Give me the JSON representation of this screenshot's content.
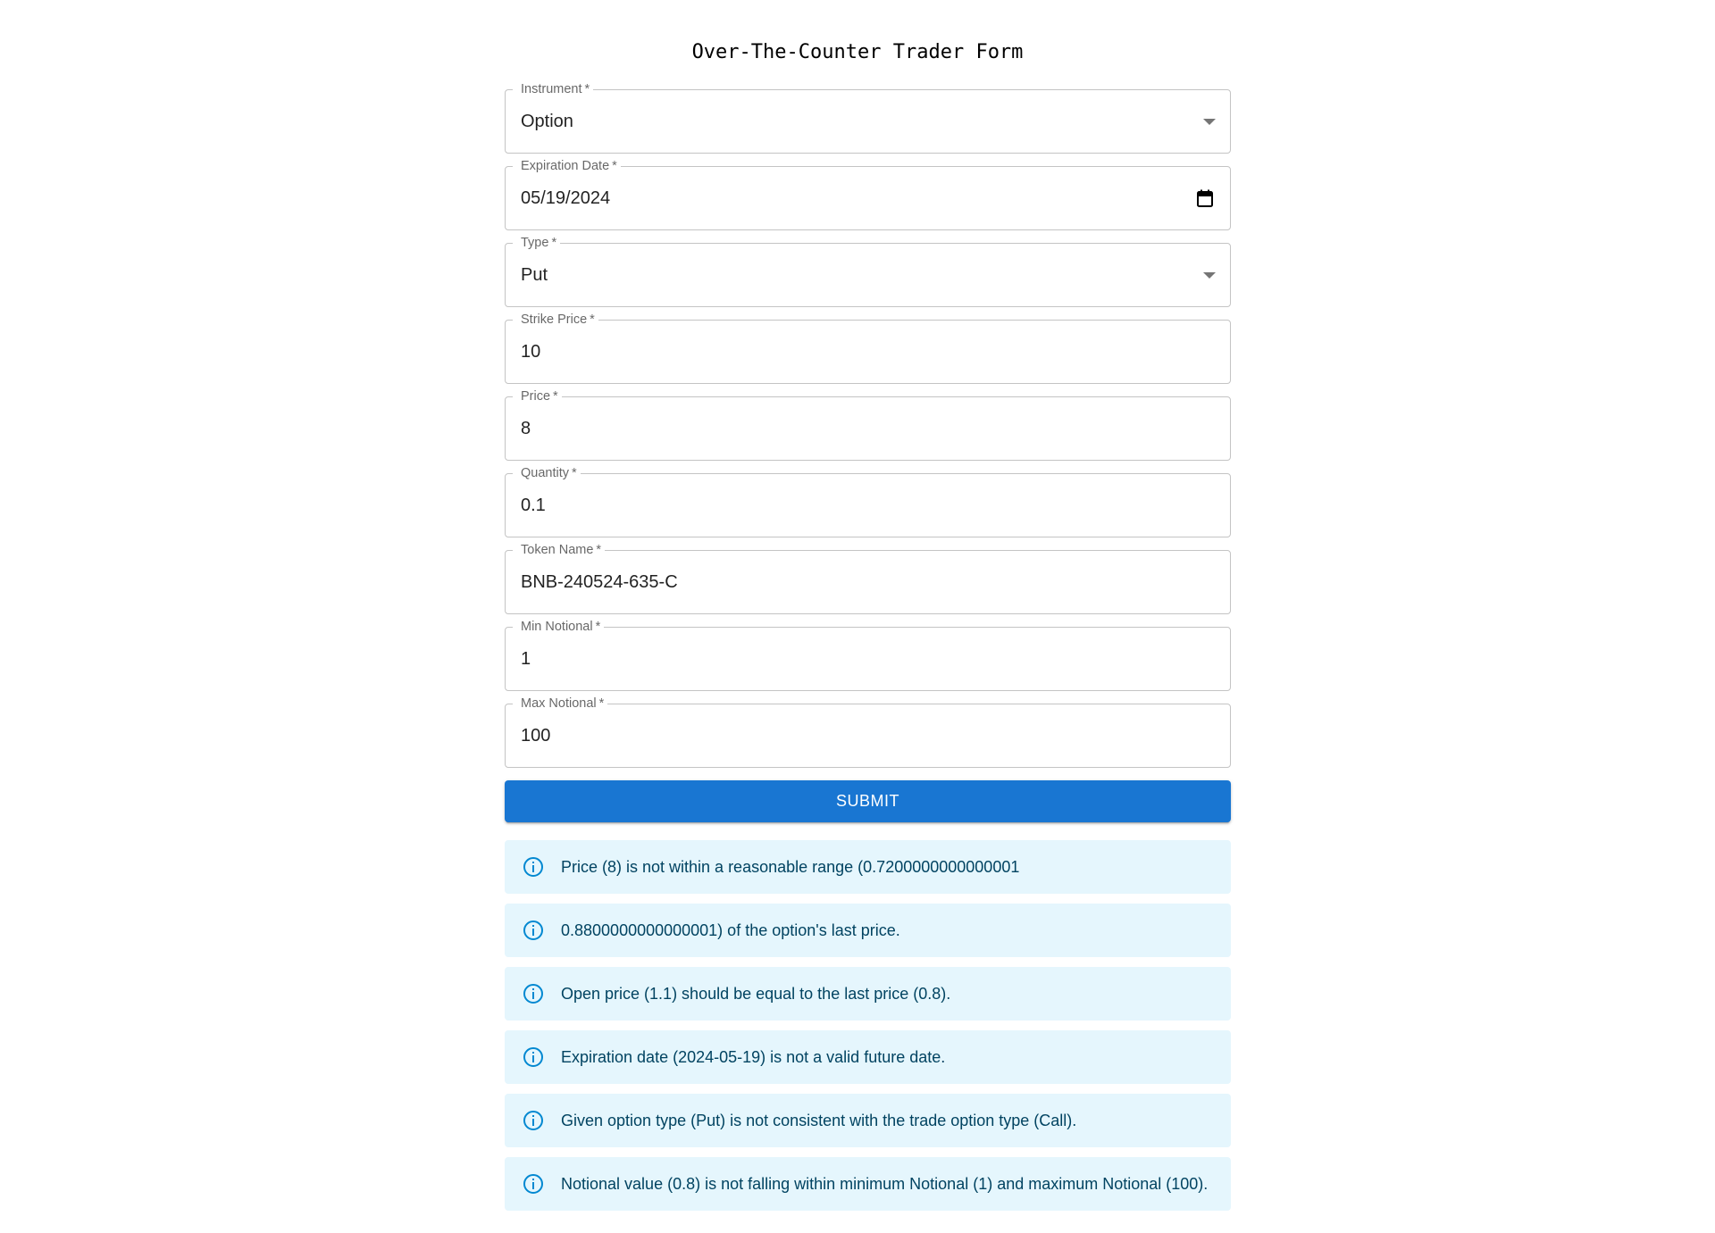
{
  "title": "Over-The-Counter Trader Form",
  "fields": [
    {
      "label": "Instrument",
      "required": "*",
      "value": "Option",
      "kind": "select"
    },
    {
      "label": "Expiration Date",
      "required": "*",
      "value": "05/19/2024",
      "kind": "date"
    },
    {
      "label": "Type",
      "required": "*",
      "value": "Put",
      "kind": "select"
    },
    {
      "label": "Strike Price",
      "required": "*",
      "value": "10",
      "kind": "text"
    },
    {
      "label": "Price",
      "required": "*",
      "value": "8",
      "kind": "text"
    },
    {
      "label": "Quantity",
      "required": "*",
      "value": "0.1",
      "kind": "text"
    },
    {
      "label": "Token Name",
      "required": "*",
      "value": "BNB-240524-635-C",
      "kind": "text"
    },
    {
      "label": "Min Notional",
      "required": "*",
      "value": "1",
      "kind": "text"
    },
    {
      "label": "Max Notional",
      "required": "*",
      "value": "100",
      "kind": "text"
    }
  ],
  "submit_label": "SUBMIT",
  "alerts": [
    {
      "icon": "info-icon",
      "message": "Price (8) is not within a reasonable range (0.7200000000000001"
    },
    {
      "icon": "info-icon",
      "message": "0.8800000000000001) of the option's last price."
    },
    {
      "icon": "info-icon",
      "message": "Open price (1.1) should be equal to the last price (0.8)."
    },
    {
      "icon": "info-icon",
      "message": "Expiration date (2024-05-19) is not a valid future date."
    },
    {
      "icon": "info-icon",
      "message": "Given option type (Put) is not consistent with the trade option type (Call)."
    },
    {
      "icon": "info-icon",
      "message": "Notional value (0.8) is not falling within minimum Notional (1) and maximum Notional (100)."
    }
  ],
  "colors": {
    "primary": "#1976d2",
    "alert_bg": "#e5f6fd",
    "alert_icon": "#0288d1",
    "alert_text": "#014361",
    "outline": "#c4c4c4"
  }
}
